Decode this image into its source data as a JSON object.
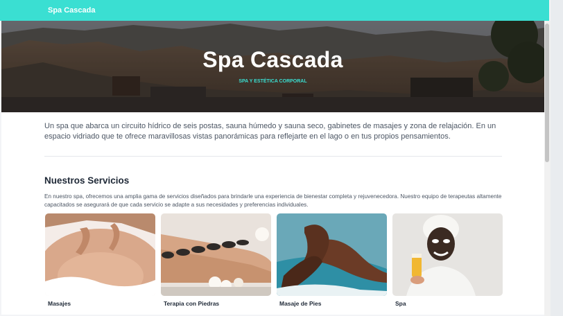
{
  "navbar": {
    "brand": "Spa Cascada"
  },
  "hero": {
    "title": "Spa Cascada",
    "subtitle": "SPA Y ESTÉTICA CORPORAL"
  },
  "intro": {
    "text": "Un spa que abarca un circuito hídrico de seis postas, sauna húmedo y sauna seco, gabinetes de masajes y zona de relajación. En un espacio vidriado que te ofrece maravillosas vistas panorámicas para reflejarte en el lago o en tus propios pensamientos."
  },
  "services": {
    "title": "Nuestros Servicios",
    "description": "En nuestro spa, ofrecemos una amplia gama de servicios diseñados para brindarle una experiencia de bienestar completa y rejuvenecedora. Nuestro equipo de terapeutas altamente capacitados se asegurará de que cada servicio se adapte a sus necesidades y preferencias individuales.",
    "items": [
      {
        "label": "Masajes",
        "icon": "massage-photo"
      },
      {
        "label": "Terapia con Piedras",
        "icon": "hot-stones-photo"
      },
      {
        "label": "Masaje de Pies",
        "icon": "foot-massage-photo"
      },
      {
        "label": "Spa",
        "icon": "face-mask-photo"
      }
    ]
  },
  "colors": {
    "accent": "#3adfd2",
    "text": "#4b5563",
    "heading": "#1f2937"
  }
}
